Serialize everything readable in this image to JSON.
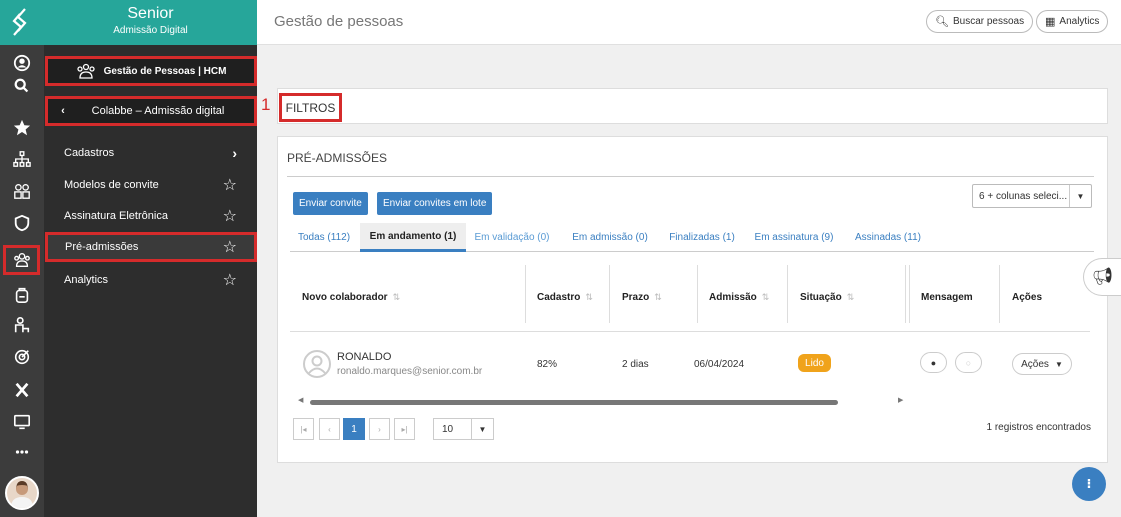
{
  "brand": {
    "name": "Senior",
    "subtitle": "Admissão Digital"
  },
  "header": {
    "title": "Gestão de pessoas",
    "search_label": "Buscar pessoas",
    "analytics_label": "Analytics"
  },
  "menu": {
    "hcm_label": "Gestão de Pessoas | HCM",
    "back_label": "Colabbe – Admissão digital",
    "items": [
      {
        "label": "Cadastros"
      },
      {
        "label": "Modelos de convite"
      },
      {
        "label": "Assinatura Eletrônica"
      },
      {
        "label": "Pré-admissões"
      },
      {
        "label": "Analytics"
      }
    ]
  },
  "annotation_number": "1",
  "filters": {
    "label": "FILTROS"
  },
  "section": {
    "title": "PRÉ-ADMISSÕES",
    "btn_invite": "Enviar convite",
    "btn_batch": "Enviar convites em lote",
    "columns_select": "6 + colunas seleci...",
    "tabs": [
      {
        "label": "Todas (112)"
      },
      {
        "label": "Em andamento (1)"
      },
      {
        "label": "Em validação (0)"
      },
      {
        "label": "Em admissão (0)"
      },
      {
        "label": "Finalizadas (1)"
      },
      {
        "label": "Em assinatura (9)"
      },
      {
        "label": "Assinadas (11)"
      }
    ],
    "columns": [
      "Novo colaborador",
      "Cadastro",
      "Prazo",
      "Admissão",
      "Situação",
      "Mensagem",
      "Ações"
    ],
    "row": {
      "name": "RONALDO",
      "email": "ronaldo.marques@senior.com.br",
      "cadastro": "82%",
      "prazo": "2 dias",
      "admissao": "06/04/2024",
      "situacao": "Lido",
      "acoes": "Ações"
    },
    "pagination": {
      "current": "1",
      "page_size": "10",
      "records": "1 registros encontrados"
    }
  },
  "colors": {
    "teal": "#26a69a",
    "accent": "#3a7fc1",
    "highlight": "#d52b2b",
    "badge": "#f0a31b"
  },
  "fab_label": "⁝"
}
